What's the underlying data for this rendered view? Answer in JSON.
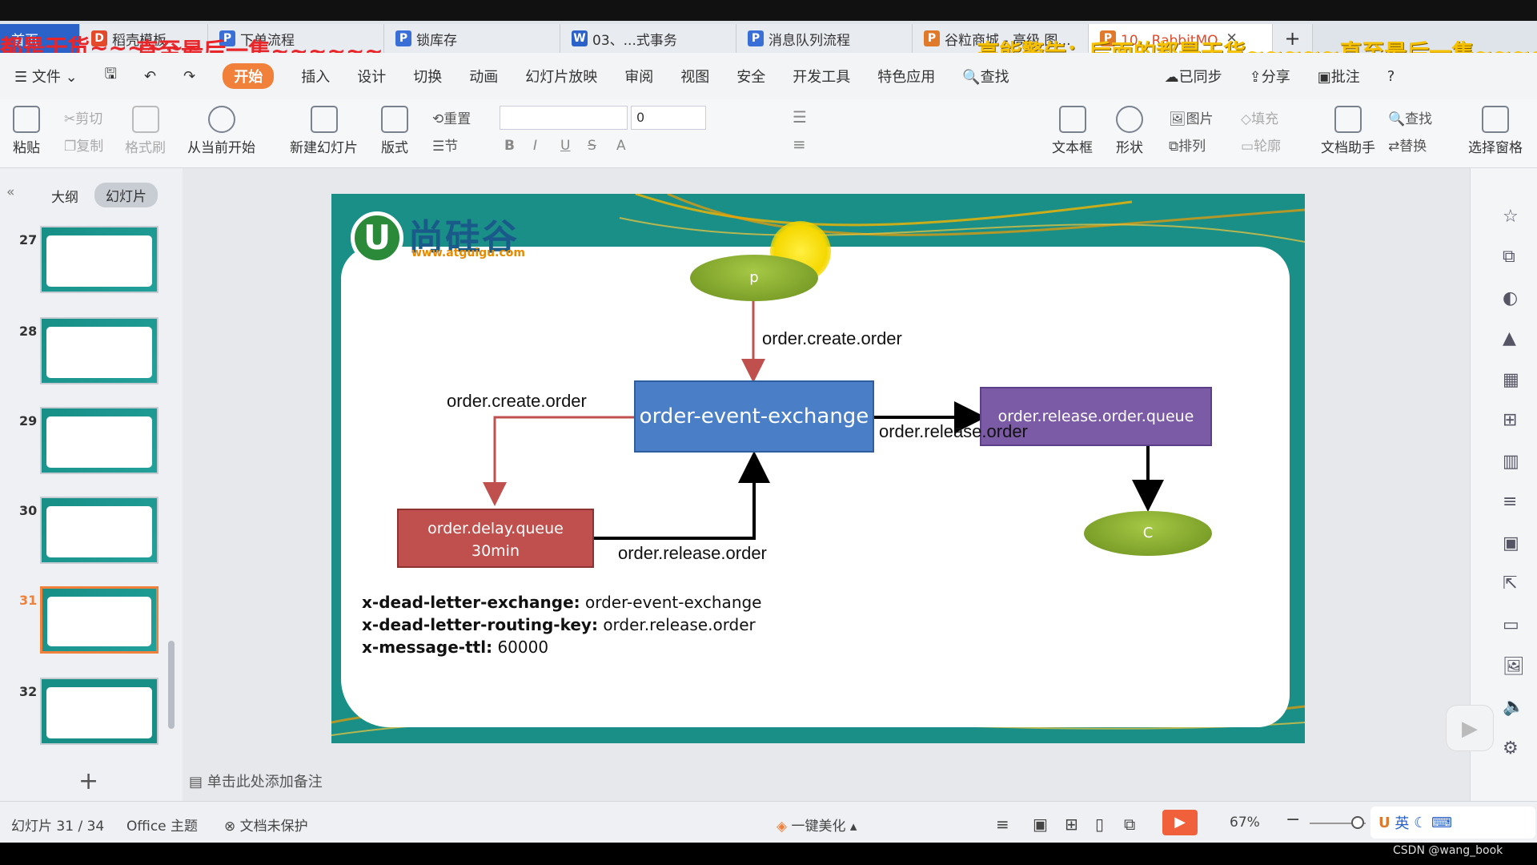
{
  "tabs": [
    {
      "label": "首页",
      "color": "#2a62c9"
    },
    {
      "label": "稻壳模板",
      "color": "#e24a2a"
    },
    {
      "label": "下单流程",
      "color": "#3b6fd8"
    },
    {
      "label": "锁库存",
      "color": "#3b6fd8"
    },
    {
      "label": "03、...式事务",
      "color": "#2a62c9"
    },
    {
      "label": "消息队列流程",
      "color": "#3b6fd8"
    },
    {
      "label": "谷粒商城 - 高级 图...",
      "color": "#e07a2a"
    },
    {
      "label": "10、RabbitMQ",
      "color": "#e07a2a"
    }
  ],
  "overlay": {
    "left_line1": "都是干货~~~~~~",
    "left_line2": "直至最后一集~~~~~~",
    "right_text": "高能警告：后面的都是干货~~~~~直至最后一集~~~~~~"
  },
  "menu": {
    "file": "文件",
    "items": [
      "开始",
      "插入",
      "设计",
      "切换",
      "动画",
      "幻灯片放映",
      "审阅",
      "视图",
      "安全",
      "开发工具",
      "特色应用"
    ],
    "search": "查找",
    "synced": "已同步",
    "share": "分享",
    "comment": "批注"
  },
  "ribbon": {
    "paste": "粘贴",
    "cut": "剪切",
    "copy": "复制",
    "format_painter": "格式刷",
    "from_current": "从当前开始",
    "new_slide": "新建幻灯片",
    "layout": "版式",
    "reset": "重置",
    "section": "节",
    "font_size": "0",
    "textbox": "文本框",
    "shape": "形状",
    "picture": "图片",
    "arrange": "排列",
    "fill": "填充",
    "outline": "轮廓",
    "doc_assistant": "文档助手",
    "find": "查找",
    "replace": "替换",
    "select_pane": "选择窗格"
  },
  "leftpane": {
    "outline_tab": "大纲",
    "slides_tab": "幻灯片",
    "slide_numbers": [
      "27",
      "28",
      "29",
      "30",
      "31",
      "32"
    ],
    "add": "+"
  },
  "slide": {
    "logo_text": "尚硅谷",
    "logo_url": "www.atguigu.com",
    "producer": "p",
    "consumer": "C",
    "exchange": "order-event-exchange",
    "release_queue": "order.release.order.queue",
    "delay_queue_line1": "order.delay.queue",
    "delay_queue_line2": "30min",
    "edge_create_top": "order.create.order",
    "edge_create_left": "order.create.order",
    "edge_release_right": "order.release.order",
    "edge_release_bottom": "order.release.order",
    "args": [
      {
        "key": "x-dead-letter-exchange:",
        "value": "order-event-exchange"
      },
      {
        "key": "x-dead-letter-routing-key:",
        "value": "order.release.order"
      },
      {
        "key": "x-message-ttl:",
        "value": "60000"
      }
    ]
  },
  "notes_placeholder": "单击此处添加备注",
  "status": {
    "slide_info": "幻灯片 31 / 34",
    "theme": "Office 主题",
    "protect": "文档未保护",
    "beautify": "一键美化",
    "zoom": "67%",
    "ime": "英",
    "watermark": "CSDN @wang_book"
  }
}
